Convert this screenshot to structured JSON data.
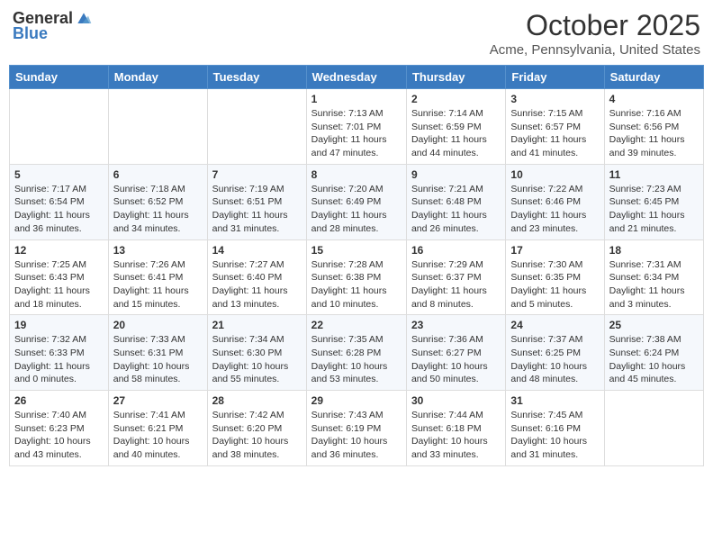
{
  "header": {
    "logo_general": "General",
    "logo_blue": "Blue",
    "month_title": "October 2025",
    "location": "Acme, Pennsylvania, United States"
  },
  "weekdays": [
    "Sunday",
    "Monday",
    "Tuesday",
    "Wednesday",
    "Thursday",
    "Friday",
    "Saturday"
  ],
  "weeks": [
    [
      {
        "day": "",
        "info": ""
      },
      {
        "day": "",
        "info": ""
      },
      {
        "day": "",
        "info": ""
      },
      {
        "day": "1",
        "info": "Sunrise: 7:13 AM\nSunset: 7:01 PM\nDaylight: 11 hours and 47 minutes."
      },
      {
        "day": "2",
        "info": "Sunrise: 7:14 AM\nSunset: 6:59 PM\nDaylight: 11 hours and 44 minutes."
      },
      {
        "day": "3",
        "info": "Sunrise: 7:15 AM\nSunset: 6:57 PM\nDaylight: 11 hours and 41 minutes."
      },
      {
        "day": "4",
        "info": "Sunrise: 7:16 AM\nSunset: 6:56 PM\nDaylight: 11 hours and 39 minutes."
      }
    ],
    [
      {
        "day": "5",
        "info": "Sunrise: 7:17 AM\nSunset: 6:54 PM\nDaylight: 11 hours and 36 minutes."
      },
      {
        "day": "6",
        "info": "Sunrise: 7:18 AM\nSunset: 6:52 PM\nDaylight: 11 hours and 34 minutes."
      },
      {
        "day": "7",
        "info": "Sunrise: 7:19 AM\nSunset: 6:51 PM\nDaylight: 11 hours and 31 minutes."
      },
      {
        "day": "8",
        "info": "Sunrise: 7:20 AM\nSunset: 6:49 PM\nDaylight: 11 hours and 28 minutes."
      },
      {
        "day": "9",
        "info": "Sunrise: 7:21 AM\nSunset: 6:48 PM\nDaylight: 11 hours and 26 minutes."
      },
      {
        "day": "10",
        "info": "Sunrise: 7:22 AM\nSunset: 6:46 PM\nDaylight: 11 hours and 23 minutes."
      },
      {
        "day": "11",
        "info": "Sunrise: 7:23 AM\nSunset: 6:45 PM\nDaylight: 11 hours and 21 minutes."
      }
    ],
    [
      {
        "day": "12",
        "info": "Sunrise: 7:25 AM\nSunset: 6:43 PM\nDaylight: 11 hours and 18 minutes."
      },
      {
        "day": "13",
        "info": "Sunrise: 7:26 AM\nSunset: 6:41 PM\nDaylight: 11 hours and 15 minutes."
      },
      {
        "day": "14",
        "info": "Sunrise: 7:27 AM\nSunset: 6:40 PM\nDaylight: 11 hours and 13 minutes."
      },
      {
        "day": "15",
        "info": "Sunrise: 7:28 AM\nSunset: 6:38 PM\nDaylight: 11 hours and 10 minutes."
      },
      {
        "day": "16",
        "info": "Sunrise: 7:29 AM\nSunset: 6:37 PM\nDaylight: 11 hours and 8 minutes."
      },
      {
        "day": "17",
        "info": "Sunrise: 7:30 AM\nSunset: 6:35 PM\nDaylight: 11 hours and 5 minutes."
      },
      {
        "day": "18",
        "info": "Sunrise: 7:31 AM\nSunset: 6:34 PM\nDaylight: 11 hours and 3 minutes."
      }
    ],
    [
      {
        "day": "19",
        "info": "Sunrise: 7:32 AM\nSunset: 6:33 PM\nDaylight: 11 hours and 0 minutes."
      },
      {
        "day": "20",
        "info": "Sunrise: 7:33 AM\nSunset: 6:31 PM\nDaylight: 10 hours and 58 minutes."
      },
      {
        "day": "21",
        "info": "Sunrise: 7:34 AM\nSunset: 6:30 PM\nDaylight: 10 hours and 55 minutes."
      },
      {
        "day": "22",
        "info": "Sunrise: 7:35 AM\nSunset: 6:28 PM\nDaylight: 10 hours and 53 minutes."
      },
      {
        "day": "23",
        "info": "Sunrise: 7:36 AM\nSunset: 6:27 PM\nDaylight: 10 hours and 50 minutes."
      },
      {
        "day": "24",
        "info": "Sunrise: 7:37 AM\nSunset: 6:25 PM\nDaylight: 10 hours and 48 minutes."
      },
      {
        "day": "25",
        "info": "Sunrise: 7:38 AM\nSunset: 6:24 PM\nDaylight: 10 hours and 45 minutes."
      }
    ],
    [
      {
        "day": "26",
        "info": "Sunrise: 7:40 AM\nSunset: 6:23 PM\nDaylight: 10 hours and 43 minutes."
      },
      {
        "day": "27",
        "info": "Sunrise: 7:41 AM\nSunset: 6:21 PM\nDaylight: 10 hours and 40 minutes."
      },
      {
        "day": "28",
        "info": "Sunrise: 7:42 AM\nSunset: 6:20 PM\nDaylight: 10 hours and 38 minutes."
      },
      {
        "day": "29",
        "info": "Sunrise: 7:43 AM\nSunset: 6:19 PM\nDaylight: 10 hours and 36 minutes."
      },
      {
        "day": "30",
        "info": "Sunrise: 7:44 AM\nSunset: 6:18 PM\nDaylight: 10 hours and 33 minutes."
      },
      {
        "day": "31",
        "info": "Sunrise: 7:45 AM\nSunset: 6:16 PM\nDaylight: 10 hours and 31 minutes."
      },
      {
        "day": "",
        "info": ""
      }
    ]
  ]
}
